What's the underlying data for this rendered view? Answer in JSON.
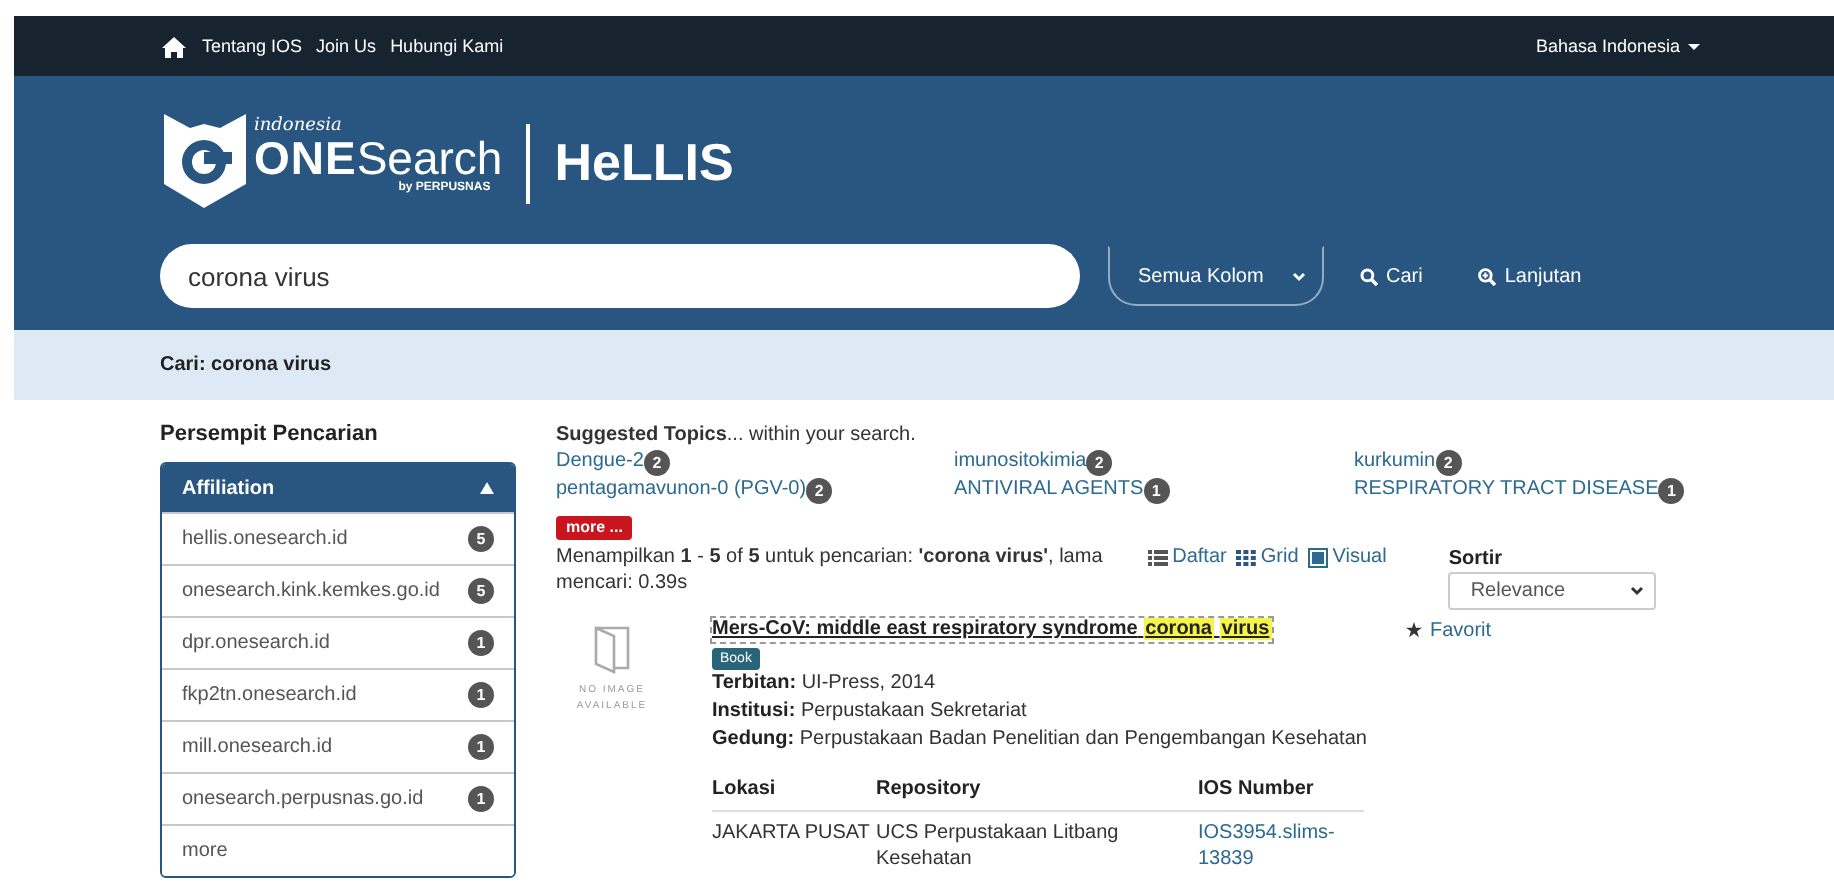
{
  "top_nav": {
    "links": [
      "Tentang IOS",
      "Join Us",
      "Hubungi Kami"
    ],
    "language": "Bahasa Indonesia"
  },
  "header": {
    "logo": {
      "small": "indonesia",
      "one": "ONE",
      "search": "Search",
      "by": "by PERPUSNAS"
    },
    "site_title": "HeLLIS"
  },
  "search": {
    "value": "corona virus",
    "scope": "Semua Kolom",
    "search_button": "Cari",
    "advanced": "Lanjutan"
  },
  "breadcrumb": "Cari: corona virus",
  "sidebar": {
    "title": "Persempit Pencarian",
    "facet": {
      "title": "Affiliation",
      "expanded": true,
      "items": [
        {
          "label": "hellis.onesearch.id",
          "count": "5"
        },
        {
          "label": "onesearch.kink.kemkes.go.id",
          "count": "5"
        },
        {
          "label": "dpr.onesearch.id",
          "count": "1"
        },
        {
          "label": "fkp2tn.onesearch.id",
          "count": "1"
        },
        {
          "label": "mill.onesearch.id",
          "count": "1"
        },
        {
          "label": "onesearch.perpusnas.go.id",
          "count": "1"
        }
      ],
      "more": "more"
    }
  },
  "suggested": {
    "heading": "Suggested Topics",
    "suffix": "... within your search.",
    "topics": [
      {
        "label": "Dengue-2",
        "count": "2"
      },
      {
        "label": "imunositokimia",
        "count": "2"
      },
      {
        "label": "kurkumin",
        "count": "2"
      },
      {
        "label": "pentagamavunon-0 (PGV-0)",
        "count": "2"
      },
      {
        "label": "ANTIVIRAL AGENTS",
        "count": "1"
      },
      {
        "label": "RESPIRATORY TRACT DISEASE",
        "count": "1"
      }
    ],
    "more": "more ..."
  },
  "summary": "Menampilkan **1** - **5** of **5** untuk pencarian: **'corona virus'**, lama mencari: 0.39s",
  "views": [
    {
      "kind": "list",
      "label": "Daftar"
    },
    {
      "kind": "grid",
      "label": "Grid"
    },
    {
      "kind": "visual",
      "label": "Visual"
    }
  ],
  "sort": {
    "label": "Sortir",
    "value": "Relevance"
  },
  "results": [
    {
      "no_image": "NO IMAGE AVAILABLE",
      "title_parts": [
        {
          "text": "Mers-CoV: middle east respiratory syndrome",
          "highlighted": false
        },
        {
          "text": "corona",
          "highlighted": true
        },
        {
          "text": "virus",
          "highlighted": true
        }
      ],
      "format": "Book",
      "details": [
        {
          "label": "Terbitan:",
          "value": "UI-Press, 2014"
        },
        {
          "label": "Institusi:",
          "value": "Perpustakaan Sekretariat"
        },
        {
          "label": "Gedung:",
          "value": "Perpustakaan Badan Penelitian dan Pengembangan Kesehatan"
        }
      ],
      "favorite": "Favorit",
      "holdings": {
        "columns": [
          "Lokasi",
          "Repository",
          "IOS Number"
        ],
        "rows": [
          [
            "JAKARTA PUSAT",
            "UCS Perpustakaan Litbang Kesehatan",
            "IOS3954.slims-13839"
          ]
        ]
      }
    }
  ]
}
